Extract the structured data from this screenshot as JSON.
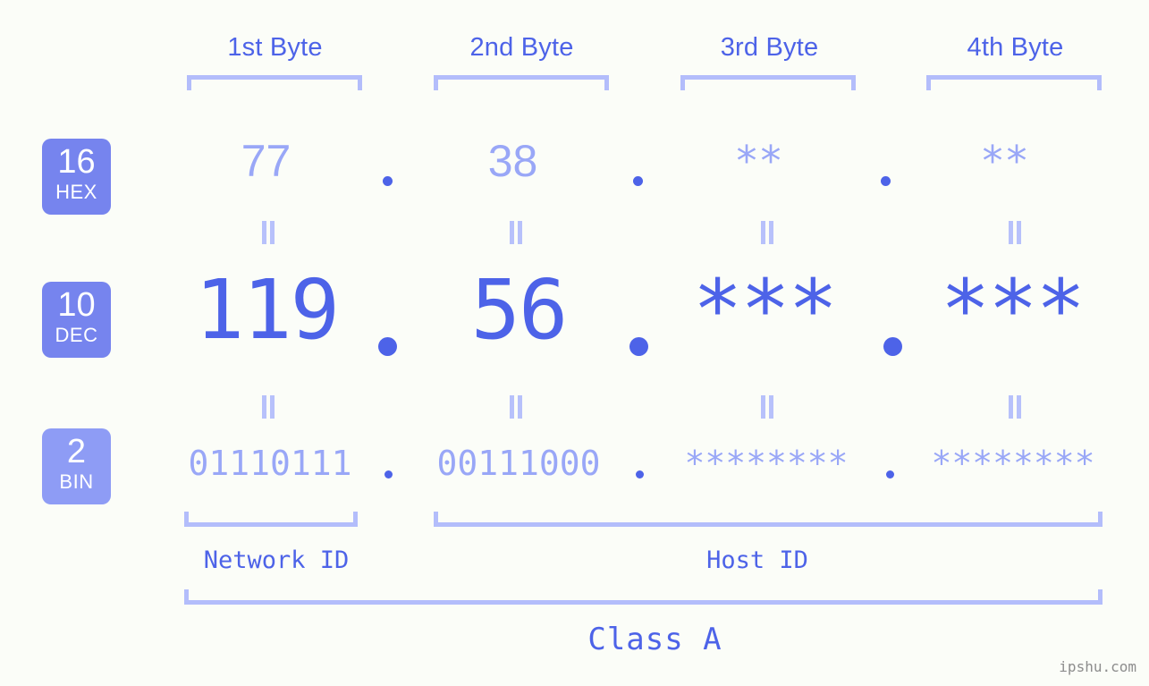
{
  "page": {
    "background_color": "#fbfdf8",
    "accent_dark": "#4d63e8",
    "accent_light": "#99a7f7",
    "bracket_color": "#b3bdfb",
    "badge_color": "#7684ee",
    "badge_color_light": "#8e9cf5",
    "watermark": "ipshu.com"
  },
  "byte_headers": [
    {
      "label": "1st Byte"
    },
    {
      "label": "2nd Byte"
    },
    {
      "label": "3rd Byte"
    },
    {
      "label": "4th Byte"
    }
  ],
  "rows": [
    {
      "badge_number": "16",
      "badge_name": "HEX",
      "values": [
        "77",
        "38",
        "**",
        "**"
      ],
      "separator": "."
    },
    {
      "badge_number": "10",
      "badge_name": "DEC",
      "values": [
        "119",
        "56",
        "***",
        "***"
      ],
      "separator": "."
    },
    {
      "badge_number": "2",
      "badge_name": "BIN",
      "values": [
        "01110111",
        "00111000",
        "********",
        "********"
      ],
      "separator": "."
    }
  ],
  "equals_marks": [
    "=",
    "=",
    "=",
    "=",
    "=",
    "=",
    "=",
    "="
  ],
  "footer": {
    "network_id_label": "Network ID",
    "host_id_label": "Host ID",
    "class_label": "Class A"
  }
}
